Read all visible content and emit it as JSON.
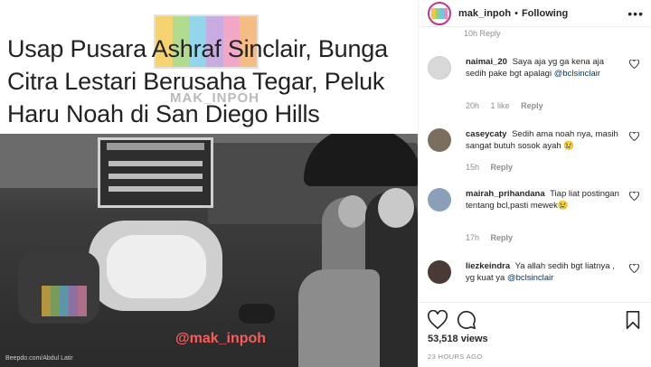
{
  "post": {
    "headline": "Usap Pusara Ashraf Sinclair, Bunga Citra Lestari Berusaha Tegar, Peluk Haru Noah di San Diego Hills",
    "watermark_top": "MAK_INPOH",
    "photo_watermark": "@mak_inpoh",
    "photo_credit": "Beepdo.com/Abdul Latir",
    "logo_colors": [
      "#f4c542",
      "#9ad06b",
      "#6fc7e3",
      "#b58fd8",
      "#f08ab3",
      "#f2a65a"
    ]
  },
  "header": {
    "username": "mak_inpoh",
    "separator": "•",
    "follow_status": "Following",
    "more_icon": "more-icon"
  },
  "comments": {
    "cut_text": "10h   Reply",
    "items": [
      {
        "username": "naimai_20",
        "text": "Saya aja yg ga kena aja sedih pake bgt apalagi",
        "mention": "@bclsinclair",
        "time": "20h",
        "likes": "1 like",
        "reply": "Reply",
        "avatar_color": "#d8d8d8"
      },
      {
        "username": "caseycaty",
        "text": "Sedih ama noah nya, masih sangat butuh sosok ayah 😢",
        "mention": "",
        "time": "15h",
        "likes": "",
        "reply": "Reply",
        "avatar_color": "#7a6e5e"
      },
      {
        "username": "mairah_prihandana",
        "text": "Tiap liat postingan tentang bcl,pasti mewek😢",
        "mention": "",
        "time": "17h",
        "likes": "",
        "reply": "Reply",
        "avatar_color": "#8aa0b8"
      },
      {
        "username": "liezkeindra",
        "text": "Ya allah sedih bgt liatnya , yg kuat ya",
        "mention": "@bclsinclair",
        "time": "",
        "likes": "",
        "reply": "",
        "avatar_color": "#4a3a36"
      }
    ]
  },
  "actions": {
    "like_icon": "heart-icon",
    "comment_icon": "comment-icon",
    "save_icon": "bookmark-icon"
  },
  "stats": {
    "views": "53,518 views",
    "time_ago": "23 HOURS AGO"
  }
}
